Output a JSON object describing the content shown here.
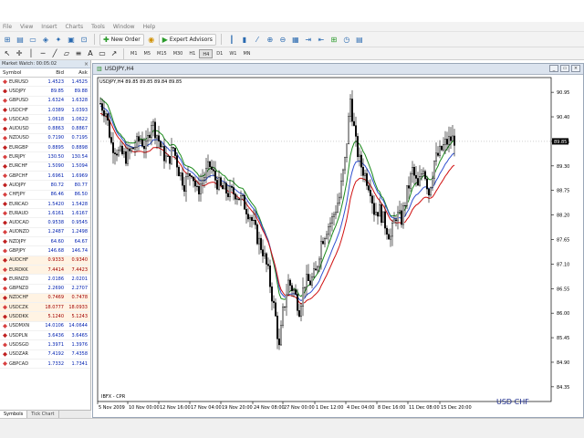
{
  "menu": [
    "File",
    "View",
    "Insert",
    "Charts",
    "Tools",
    "Window",
    "Help"
  ],
  "toolbar": {
    "new_order_label": "New Order",
    "expert_advisors_label": "Expert Advisors",
    "timeframes": [
      "M1",
      "M5",
      "M15",
      "M30",
      "H1",
      "H4",
      "D1",
      "W1",
      "MN"
    ]
  },
  "market_watch": {
    "title": "Market Watch: 00:05:02",
    "close_glyph": "×",
    "col_symbol": "Symbol",
    "col_bid": "Bid",
    "col_ask": "Ask",
    "rows": [
      {
        "symbol": "EURUSD",
        "bid": "1.4523",
        "ask": "1.4525",
        "alt": false
      },
      {
        "symbol": "USDJPY",
        "bid": "89.85",
        "ask": "89.88",
        "alt": false
      },
      {
        "symbol": "GBPUSD",
        "bid": "1.6324",
        "ask": "1.6328",
        "alt": false
      },
      {
        "symbol": "USDCHF",
        "bid": "1.0389",
        "ask": "1.0393",
        "alt": false
      },
      {
        "symbol": "USDCAD",
        "bid": "1.0618",
        "ask": "1.0622",
        "alt": false
      },
      {
        "symbol": "AUDUSD",
        "bid": "0.8863",
        "ask": "0.8867",
        "alt": false
      },
      {
        "symbol": "NZDUSD",
        "bid": "0.7190",
        "ask": "0.7195",
        "alt": false
      },
      {
        "symbol": "EURGBP",
        "bid": "0.8895",
        "ask": "0.8898",
        "alt": false
      },
      {
        "symbol": "EURJPY",
        "bid": "130.50",
        "ask": "130.54",
        "alt": false
      },
      {
        "symbol": "EURCHF",
        "bid": "1.5090",
        "ask": "1.5094",
        "alt": false
      },
      {
        "symbol": "GBPCHF",
        "bid": "1.6961",
        "ask": "1.6969",
        "alt": false
      },
      {
        "symbol": "AUDJPY",
        "bid": "80.72",
        "ask": "80.77",
        "alt": false
      },
      {
        "symbol": "CHFJPY",
        "bid": "86.46",
        "ask": "86.50",
        "alt": false
      },
      {
        "symbol": "EURCAD",
        "bid": "1.5420",
        "ask": "1.5428",
        "alt": false
      },
      {
        "symbol": "EURAUD",
        "bid": "1.6161",
        "ask": "1.6167",
        "alt": false
      },
      {
        "symbol": "AUDCAD",
        "bid": "0.9538",
        "ask": "0.9545",
        "alt": false
      },
      {
        "symbol": "AUDNZD",
        "bid": "1.2487",
        "ask": "1.2498",
        "alt": false
      },
      {
        "symbol": "NZDJPY",
        "bid": "64.60",
        "ask": "64.67",
        "alt": false
      },
      {
        "symbol": "GBPJPY",
        "bid": "146.68",
        "ask": "146.74",
        "alt": false
      },
      {
        "symbol": "AUDCHF",
        "bid": "0.9333",
        "ask": "0.9340",
        "alt": true
      },
      {
        "symbol": "EURDKK",
        "bid": "7.4414",
        "ask": "7.4423",
        "alt": true
      },
      {
        "symbol": "EURNZD",
        "bid": "2.0186",
        "ask": "2.0201",
        "alt": false
      },
      {
        "symbol": "GBPNZD",
        "bid": "2.2690",
        "ask": "2.2707",
        "alt": false
      },
      {
        "symbol": "NZDCHF",
        "bid": "0.7469",
        "ask": "0.7478",
        "alt": true
      },
      {
        "symbol": "USDCZK",
        "bid": "18.0777",
        "ask": "18.0933",
        "alt": true
      },
      {
        "symbol": "USDDKK",
        "bid": "5.1240",
        "ask": "5.1243",
        "alt": true
      },
      {
        "symbol": "USDMXN",
        "bid": "14.0106",
        "ask": "14.0644",
        "alt": false
      },
      {
        "symbol": "USDPLN",
        "bid": "3.6436",
        "ask": "3.6465",
        "alt": false
      },
      {
        "symbol": "USDSGD",
        "bid": "1.3971",
        "ask": "1.3976",
        "alt": false
      },
      {
        "symbol": "USDZAR",
        "bid": "7.4192",
        "ask": "7.4358",
        "alt": false
      },
      {
        "symbol": "GBPCAD",
        "bid": "1.7332",
        "ask": "1.7341",
        "alt": false
      }
    ],
    "tabs": [
      "Symbols",
      "Tick Chart"
    ]
  },
  "chart_window": {
    "title": "USDJPY,H4",
    "info": "USDJPY,H4  89.85 89.85 89.84 89.85",
    "indicator_label": "IBFX - CPR",
    "bottom_right_label": "USD    CHF",
    "current_price": "89.85",
    "price_ticks": [
      "90.95",
      "90.40",
      "89.85",
      "89.30",
      "88.75",
      "88.20",
      "87.65",
      "87.10",
      "86.55",
      "86.00",
      "85.45",
      "84.90",
      "84.35"
    ],
    "time_ticks": [
      "5 Nov 2009",
      "10 Nov 00:00",
      "12 Nov 16:00",
      "17 Nov 04:00",
      "19 Nov 20:00",
      "24 Nov 08:00",
      "27 Nov 00:00",
      "1 Dec 12:00",
      "4 Dec 04:00",
      "8 Dec 16:00",
      "11 Dec 08:00",
      "15 Dec 20:00"
    ]
  },
  "colors": {
    "bull_candle": "#ffffff",
    "bear_candle": "#000000",
    "ma_green": "#1a8a1a",
    "ma_blue": "#3050d0",
    "ma_red": "#d01010"
  }
}
